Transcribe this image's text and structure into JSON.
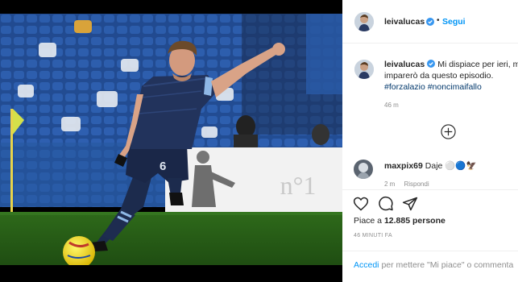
{
  "post": {
    "author": "leivalucas",
    "follow_label": "Segui",
    "header_separator": "•",
    "caption": {
      "username": "leivalucas",
      "line1": "Mi dispiace per ieri, m",
      "line2": "imparerò da questo episodio.",
      "hashtags": "#forzalazio #noncimaifallo"
    },
    "caption_time": "46 m",
    "comment": {
      "username": "maxpix69",
      "text": "Daje",
      "emoji": "⚪🔵🦅",
      "meta_time": "2 m",
      "reply_label": "Rispondi"
    },
    "likes_prefix": "Piace a",
    "likes_count": "12.885",
    "likes_suffix": "persone",
    "timestamp": "46 MINUTI FA",
    "login_link": "Accedi",
    "login_text": "per mettere \"Mi piace\" o commenta"
  },
  "photo": {
    "jersey_number": "6",
    "board_text": "n°1"
  },
  "colors": {
    "accent": "#0095f6",
    "hashtag": "#00376b",
    "muted": "#8e8e8e",
    "text": "#262626",
    "pitch": "#2f6b1d",
    "stands_blue": "#214f99"
  },
  "icons": [
    "verified-badge-icon",
    "plus-circle-icon",
    "heart-icon",
    "comment-icon",
    "share-icon"
  ]
}
